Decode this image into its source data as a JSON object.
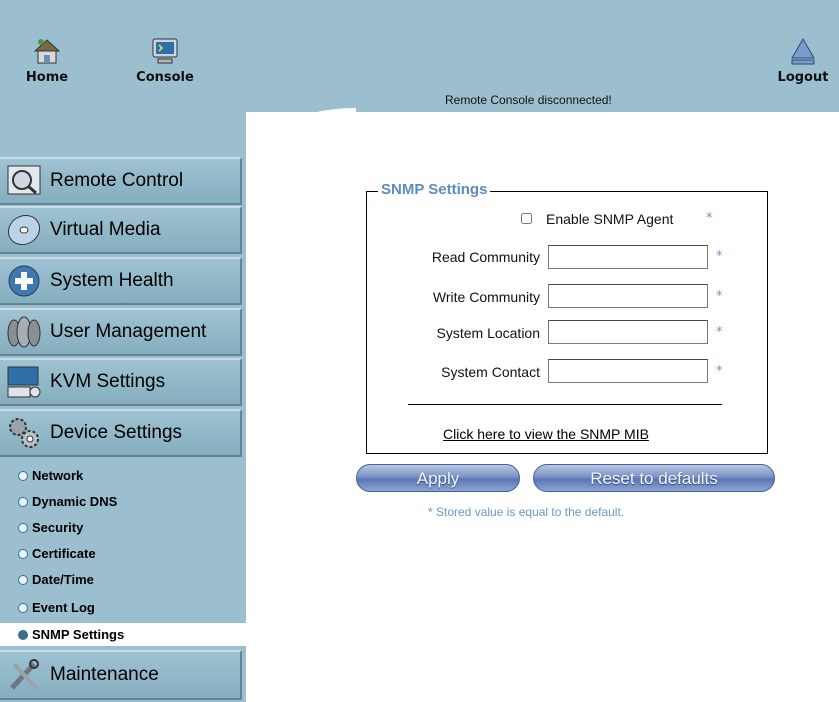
{
  "header": {
    "home_label": "Home",
    "console_label": "Console",
    "logout_label": "Logout",
    "status_text": "Remote Console disconnected!"
  },
  "sidebar": {
    "menus": [
      {
        "label": "Remote Control",
        "icon": "monitor-icon"
      },
      {
        "label": "Virtual Media",
        "icon": "disc-icon"
      },
      {
        "label": "System Health",
        "icon": "health-icon"
      },
      {
        "label": "User Management",
        "icon": "users-icon"
      },
      {
        "label": "KVM Settings",
        "icon": "keyboard-icon"
      },
      {
        "label": "Device Settings",
        "icon": "gears-icon"
      }
    ],
    "device_submenu": [
      {
        "label": "Network"
      },
      {
        "label": "Dynamic DNS"
      },
      {
        "label": "Security"
      },
      {
        "label": "Certificate"
      },
      {
        "label": "Date/Time"
      },
      {
        "label": "Event Log"
      },
      {
        "label": "SNMP Settings",
        "active": true
      }
    ],
    "maintenance_label": "Maintenance"
  },
  "snmp": {
    "legend": "SNMP Settings",
    "enable_label": "Enable SNMP Agent",
    "enable_checked": false,
    "required_marker": "*",
    "fields": [
      {
        "label": "Read Community",
        "value": ""
      },
      {
        "label": "Write Community",
        "value": ""
      },
      {
        "label": "System Location",
        "value": ""
      },
      {
        "label": "System Contact",
        "value": ""
      }
    ],
    "mib_link": "Click here to view the SNMP MIB"
  },
  "actions": {
    "apply_label": "Apply",
    "reset_label": "Reset to defaults",
    "note": "* Stored value is equal to the default."
  },
  "colors": {
    "panel_bg": "#9bbfce",
    "legend_color": "#5b8cc0",
    "star_color": "#6d97c3",
    "button_color": "#5a77b5"
  }
}
